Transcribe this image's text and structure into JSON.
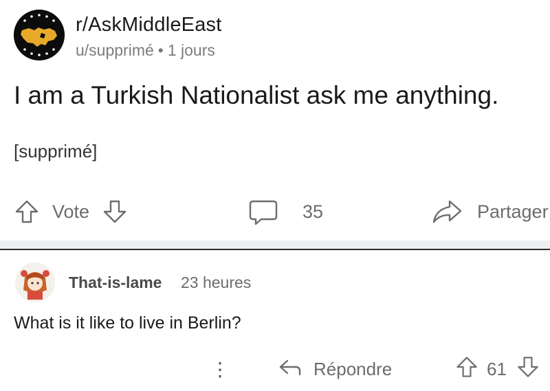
{
  "post": {
    "subreddit": "r/AskMiddleEast",
    "author": "u/supprimé",
    "separator": "•",
    "time": "1 jours",
    "title": "I am a Turkish Nationalist ask me anything.",
    "body": "[supprimé]",
    "actions": {
      "vote_label": "Vote",
      "comment_count": "35",
      "share_label": "Partager"
    }
  },
  "comment": {
    "author": "That-is-lame",
    "time": "23 heures",
    "text": "What is it like to live in Berlin?",
    "actions": {
      "more": "⋮",
      "reply_label": "Répondre",
      "score": "61"
    }
  },
  "icons": {
    "subreddit_avatar": "subreddit-avatar-icon",
    "upvote": "upvote-arrow-icon",
    "downvote": "downvote-arrow-icon",
    "comment": "comment-bubble-icon",
    "share": "share-arrow-icon",
    "reply": "reply-arrow-icon",
    "user_avatar": "user-avatar-icon"
  },
  "colors": {
    "text": "#1a1a1b",
    "muted": "#7c7c7c",
    "avatar_bg": "#0c0c0c",
    "avatar_map": "#e8a92a",
    "divider": "#edeff1"
  }
}
